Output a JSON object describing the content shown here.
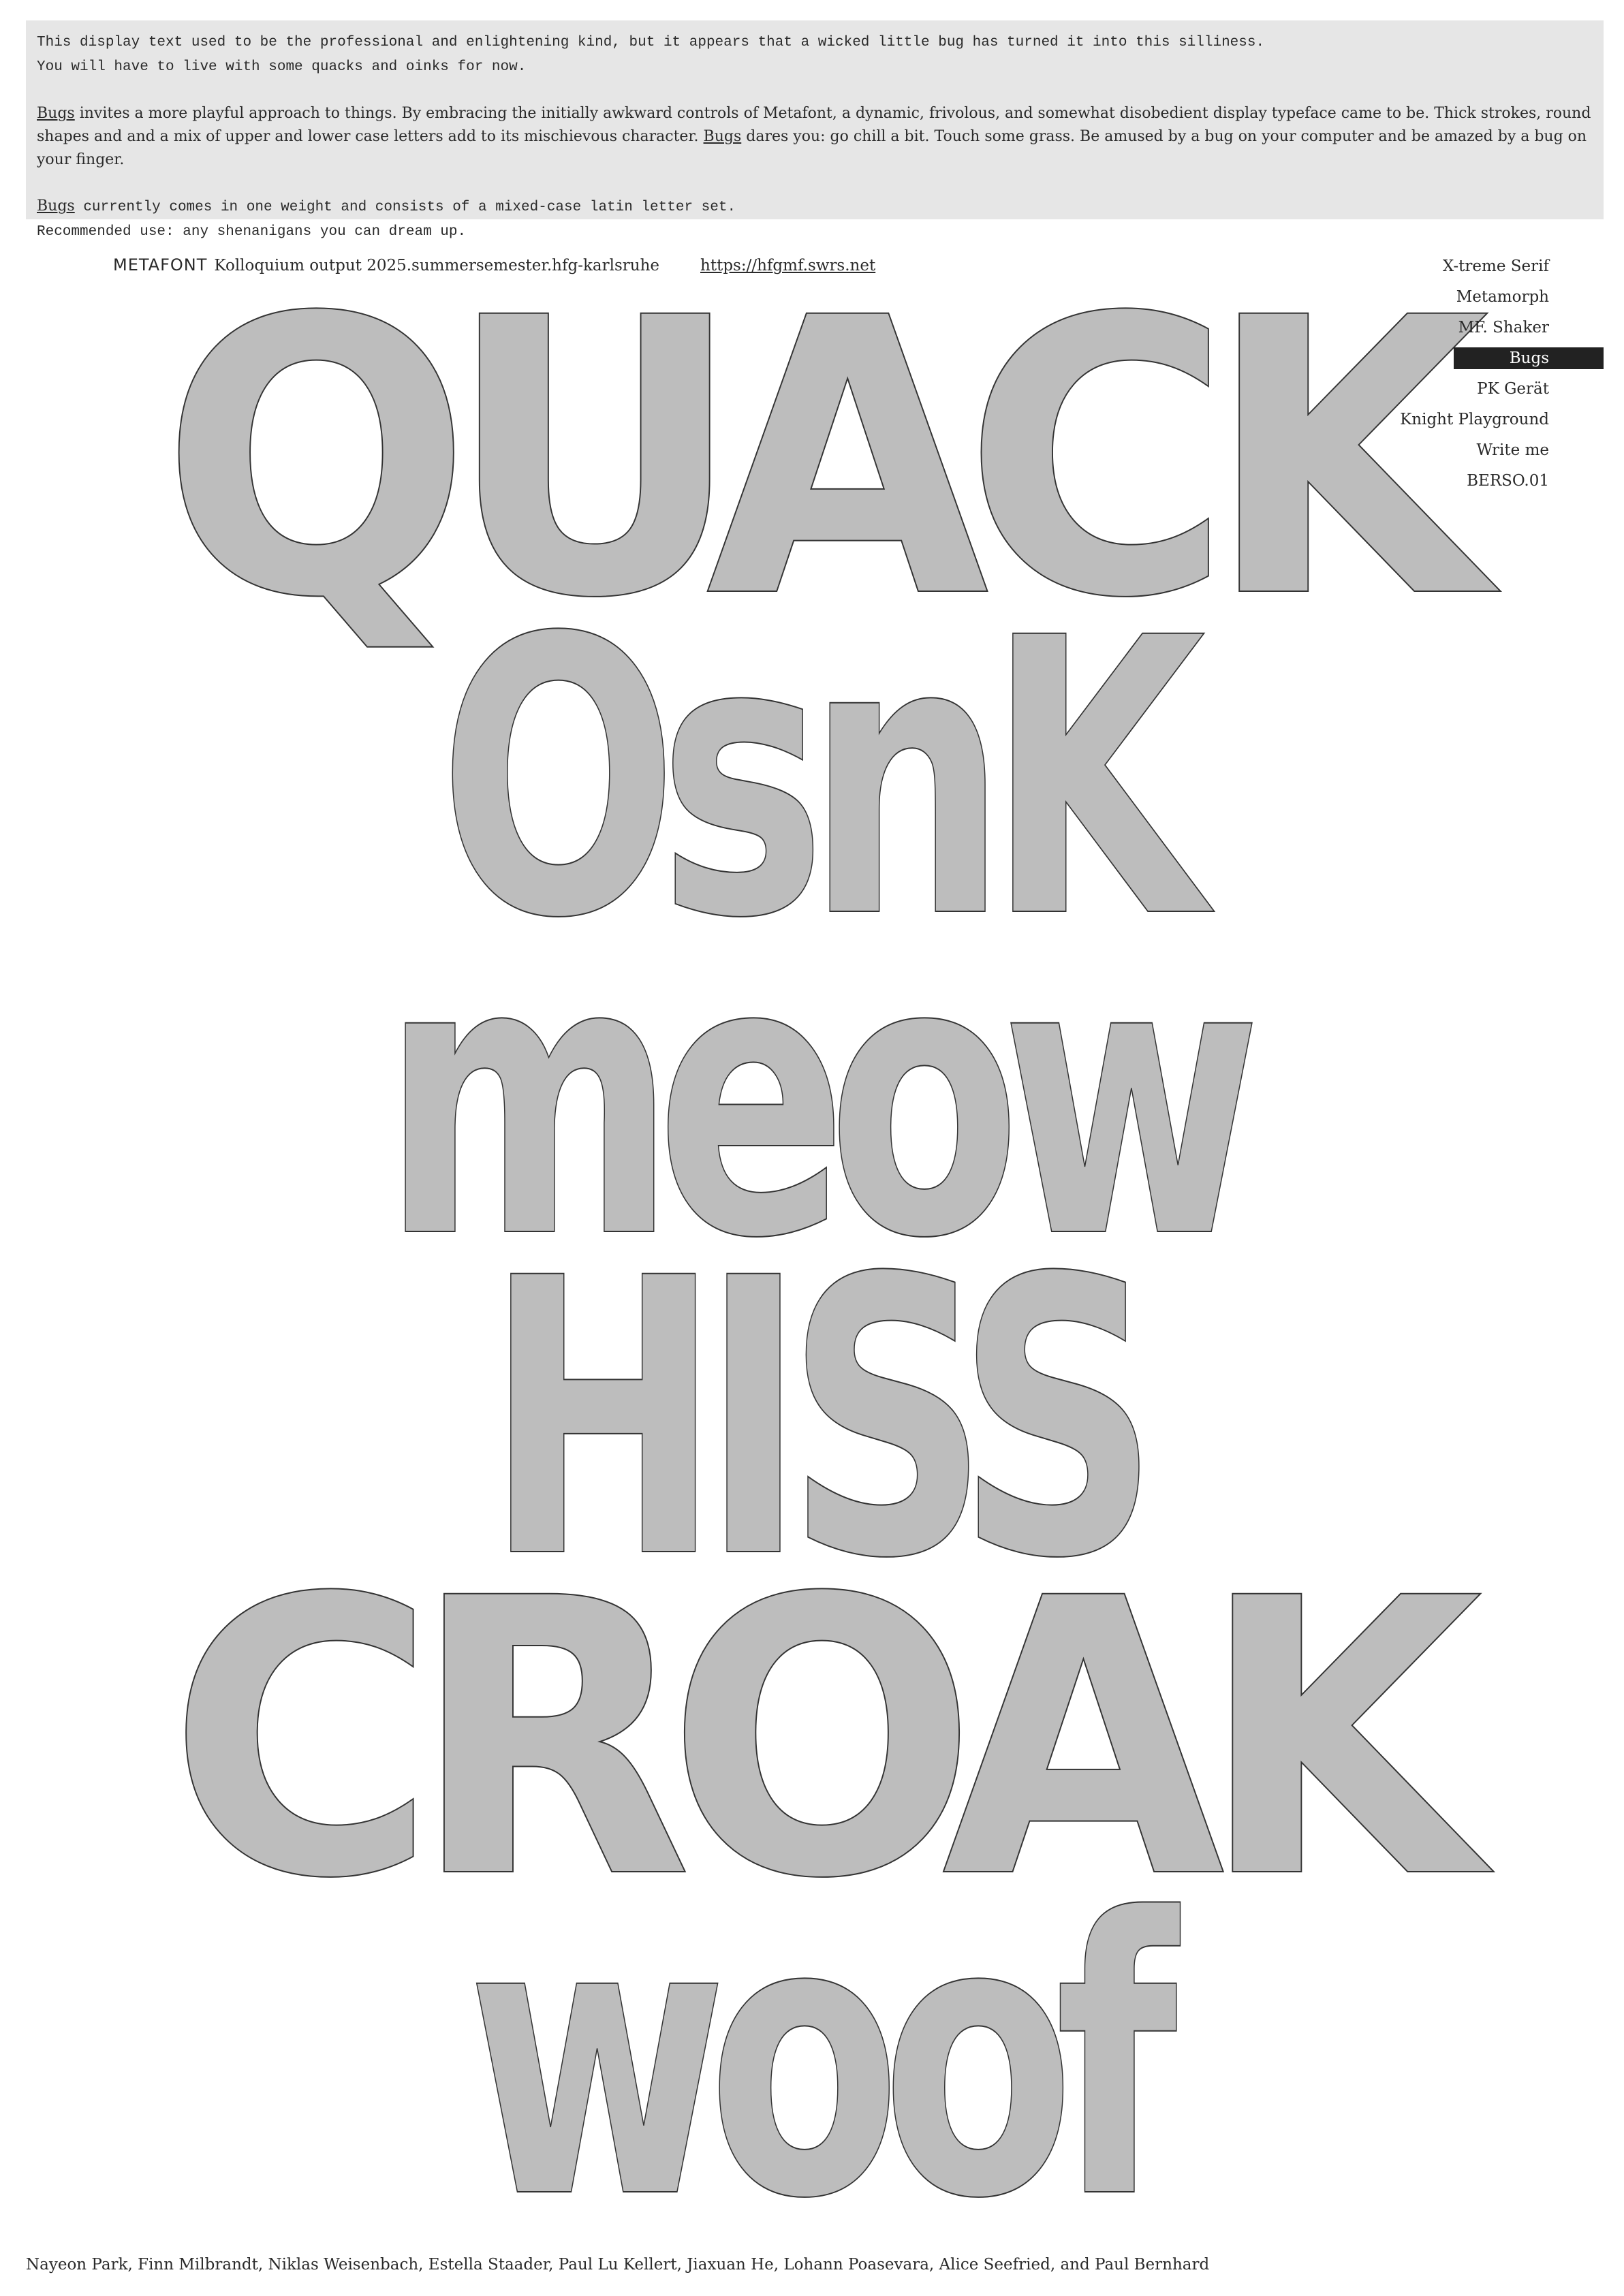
{
  "intro": {
    "line1": "This display text used to be the professional and enlightening kind, but it appears that a wicked little bug has turned it into this silliness.",
    "line2": "You will have to live with some quacks and oinks for now.",
    "p2_link": "Bugs",
    "p2_text_a": " invites a more playful approach to things. By embracing the initially awkward controls of  Metafont, a dynamic, frivolous, and somewhat disobedient display typeface came to be. Thick strokes, round shapes and and a mix of upper and lower case letters add to its mischievous character. ",
    "p2_link2": "Bugs",
    "p2_text_b": " dares you: go chill a bit. Touch some grass. Be amused by a bug on your computer and be amazed by a bug on your finger.",
    "p3_link": "Bugs",
    "p3_text": " currently comes in one weight and consists of a mixed-case latin letter set.",
    "p3_line2": "Recommended use: any shenanigans you can dream up."
  },
  "header": {
    "brand": "METAFONT",
    "subtitle": "Kolloquium output 2025.summersemester.hfg-karlsruhe",
    "url": "https://hfgmf.swrs.net"
  },
  "menu": {
    "items": [
      {
        "label": "X-treme Serif",
        "active": false
      },
      {
        "label": "Metamorph",
        "active": false
      },
      {
        "label": "MF. Shaker",
        "active": false
      },
      {
        "label": "Bugs",
        "active": true
      },
      {
        "label": "PK Gerät",
        "active": false
      },
      {
        "label": "Knight Playground",
        "active": false
      },
      {
        "label": "Write me",
        "active": false
      },
      {
        "label": "BERSO.01",
        "active": false
      }
    ]
  },
  "specimen": {
    "words": [
      "QUACK",
      "OsnK",
      "meow",
      "HISS",
      "CROAK",
      "woof"
    ]
  },
  "credits": "Nayeon Park, Finn Milbrandt, Niklas Weisenbach, Estella Staader, Paul Lu Kellert, Jiaxuan He, Lohann Poasevara, Alice Seefried, and Paul Bernhard",
  "colors": {
    "intro_bg": "#e6e6e6",
    "glyph_fill": "#bdbdbd",
    "glyph_stroke": "#333333",
    "active_menu_bg": "#222222"
  }
}
